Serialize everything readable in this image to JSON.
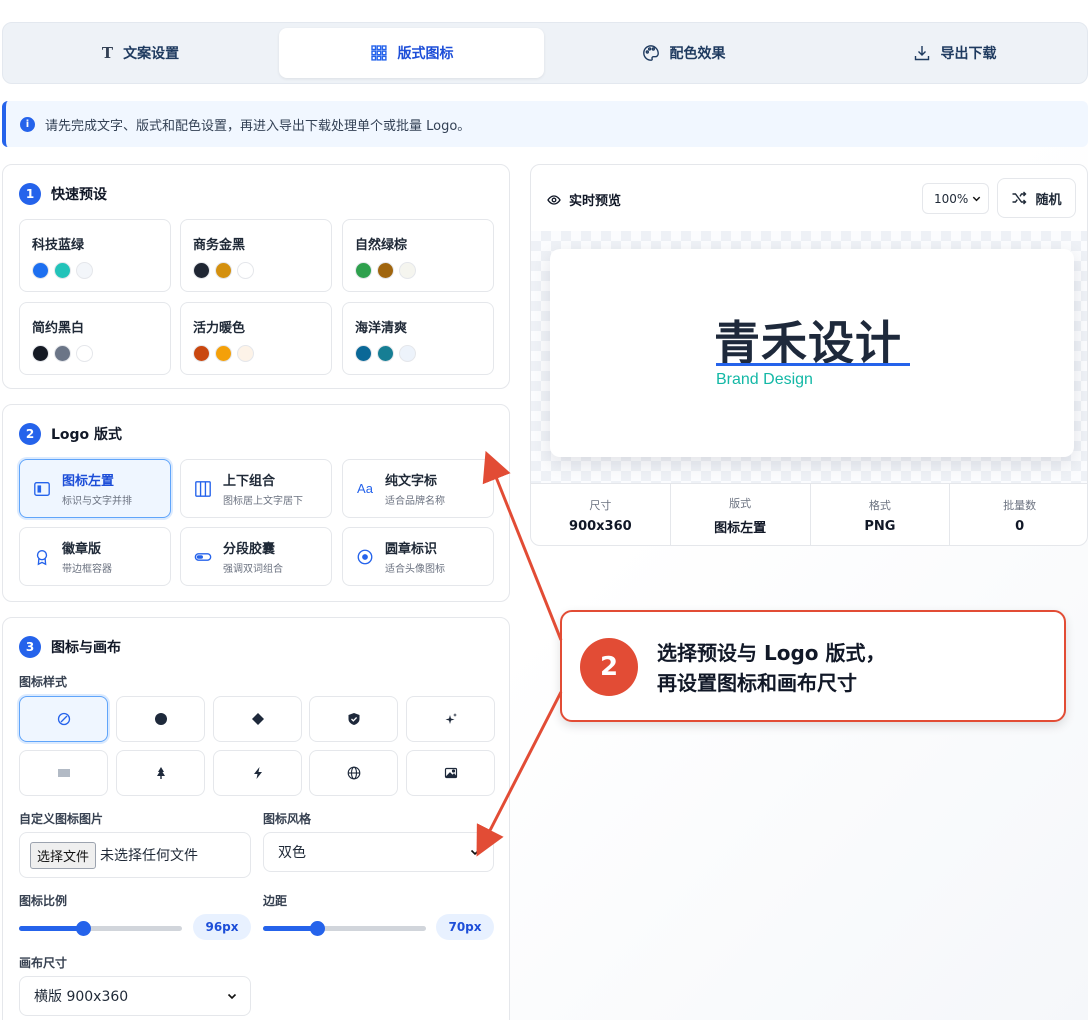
{
  "tabs": [
    {
      "label": "文案设置",
      "icon": "text-icon",
      "active": false
    },
    {
      "label": "版式图标",
      "icon": "grid-icon",
      "active": true
    },
    {
      "label": "配色效果",
      "icon": "palette-icon",
      "active": false
    },
    {
      "label": "导出下载",
      "icon": "download-icon",
      "active": false
    }
  ],
  "banner": {
    "text": "请先完成文字、版式和配色设置，再进入导出下载处理单个或批量 Logo。",
    "icon": "info-icon"
  },
  "presets": {
    "number": "1",
    "title": "快速预设",
    "items": [
      {
        "name": "科技蓝绿",
        "colors": [
          "#1d6ff0",
          "#22c3b9",
          "#f3f6fa"
        ]
      },
      {
        "name": "商务金黑",
        "colors": [
          "#1f2633",
          "#d4900f",
          "#ffffff"
        ]
      },
      {
        "name": "自然绿棕",
        "colors": [
          "#2ea04d",
          "#a0650e",
          "#f5f5ef"
        ]
      },
      {
        "name": "简约黑白",
        "colors": [
          "#151a24",
          "#6b7587",
          "#ffffff"
        ]
      },
      {
        "name": "活力暖色",
        "colors": [
          "#c9470f",
          "#f4a009",
          "#fdf3e8"
        ]
      },
      {
        "name": "海洋清爽",
        "colors": [
          "#0a6897",
          "#167e94",
          "#edf3fb"
        ]
      }
    ]
  },
  "layouts": {
    "number": "2",
    "title": "Logo 版式",
    "items": [
      {
        "title": "图标左置",
        "sub": "标识与文字并排",
        "icon": "icon-left-layout-icon",
        "active": true
      },
      {
        "title": "上下组合",
        "sub": "图标居上文字居下",
        "icon": "columns-layout-icon",
        "active": false
      },
      {
        "title": "纯文字标",
        "sub": "适合品牌名称",
        "icon": "text-aa-icon",
        "active": false
      },
      {
        "title": "徽章版",
        "sub": "带边框容器",
        "icon": "badge-icon",
        "active": false
      },
      {
        "title": "分段胶囊",
        "sub": "强调双词组合",
        "icon": "capsule-toggle-icon",
        "active": false
      },
      {
        "title": "圆章标识",
        "sub": "适合头像图标",
        "icon": "radio-circle-icon",
        "active": false
      }
    ]
  },
  "canvas_section": {
    "number": "3",
    "title": "图标与画布",
    "icon_style_label": "图标样式",
    "icon_styles": [
      {
        "icon": "none-icon",
        "active": true
      },
      {
        "icon": "circle-icon",
        "active": false
      },
      {
        "icon": "diamond-icon",
        "active": false
      },
      {
        "icon": "shield-icon",
        "active": false
      },
      {
        "icon": "sparkle-icon",
        "active": false
      },
      {
        "icon": "waves-icon",
        "active": false
      },
      {
        "icon": "tree-icon",
        "active": false
      },
      {
        "icon": "lightning-icon",
        "active": false
      },
      {
        "icon": "globe-icon",
        "active": false
      },
      {
        "icon": "image-icon",
        "active": false
      }
    ],
    "custom_image_label": "自定义图标图片",
    "file_button": "选择文件",
    "file_status": "未选择任何文件",
    "icon_style_select_label": "图标风格",
    "icon_style_select_value": "双色",
    "scale_label": "图标比例",
    "scale_value": "96px",
    "scale_level": 0.39,
    "padding_label": "边距",
    "padding_value": "70px",
    "padding_level": 0.33,
    "canvas_size_label": "画布尺寸",
    "canvas_size_value": "横版 900x360"
  },
  "preview": {
    "title": "实时预览",
    "zoom": "100%",
    "random_label": "随机",
    "logo_text": "青禾设计",
    "logo_sub": "Brand Design",
    "stats": [
      {
        "label": "尺寸",
        "value": "900x360"
      },
      {
        "label": "版式",
        "value": "图标左置"
      },
      {
        "label": "格式",
        "value": "PNG"
      },
      {
        "label": "批量数",
        "value": "0"
      }
    ]
  },
  "callout": {
    "number": "2",
    "line1": "选择预设与 Logo 版式，",
    "line2": "再设置图标和画布尺寸"
  },
  "colors": {
    "accent": "#2563eb",
    "callout": "#e24c35",
    "brand_sub": "#14b8a6"
  }
}
